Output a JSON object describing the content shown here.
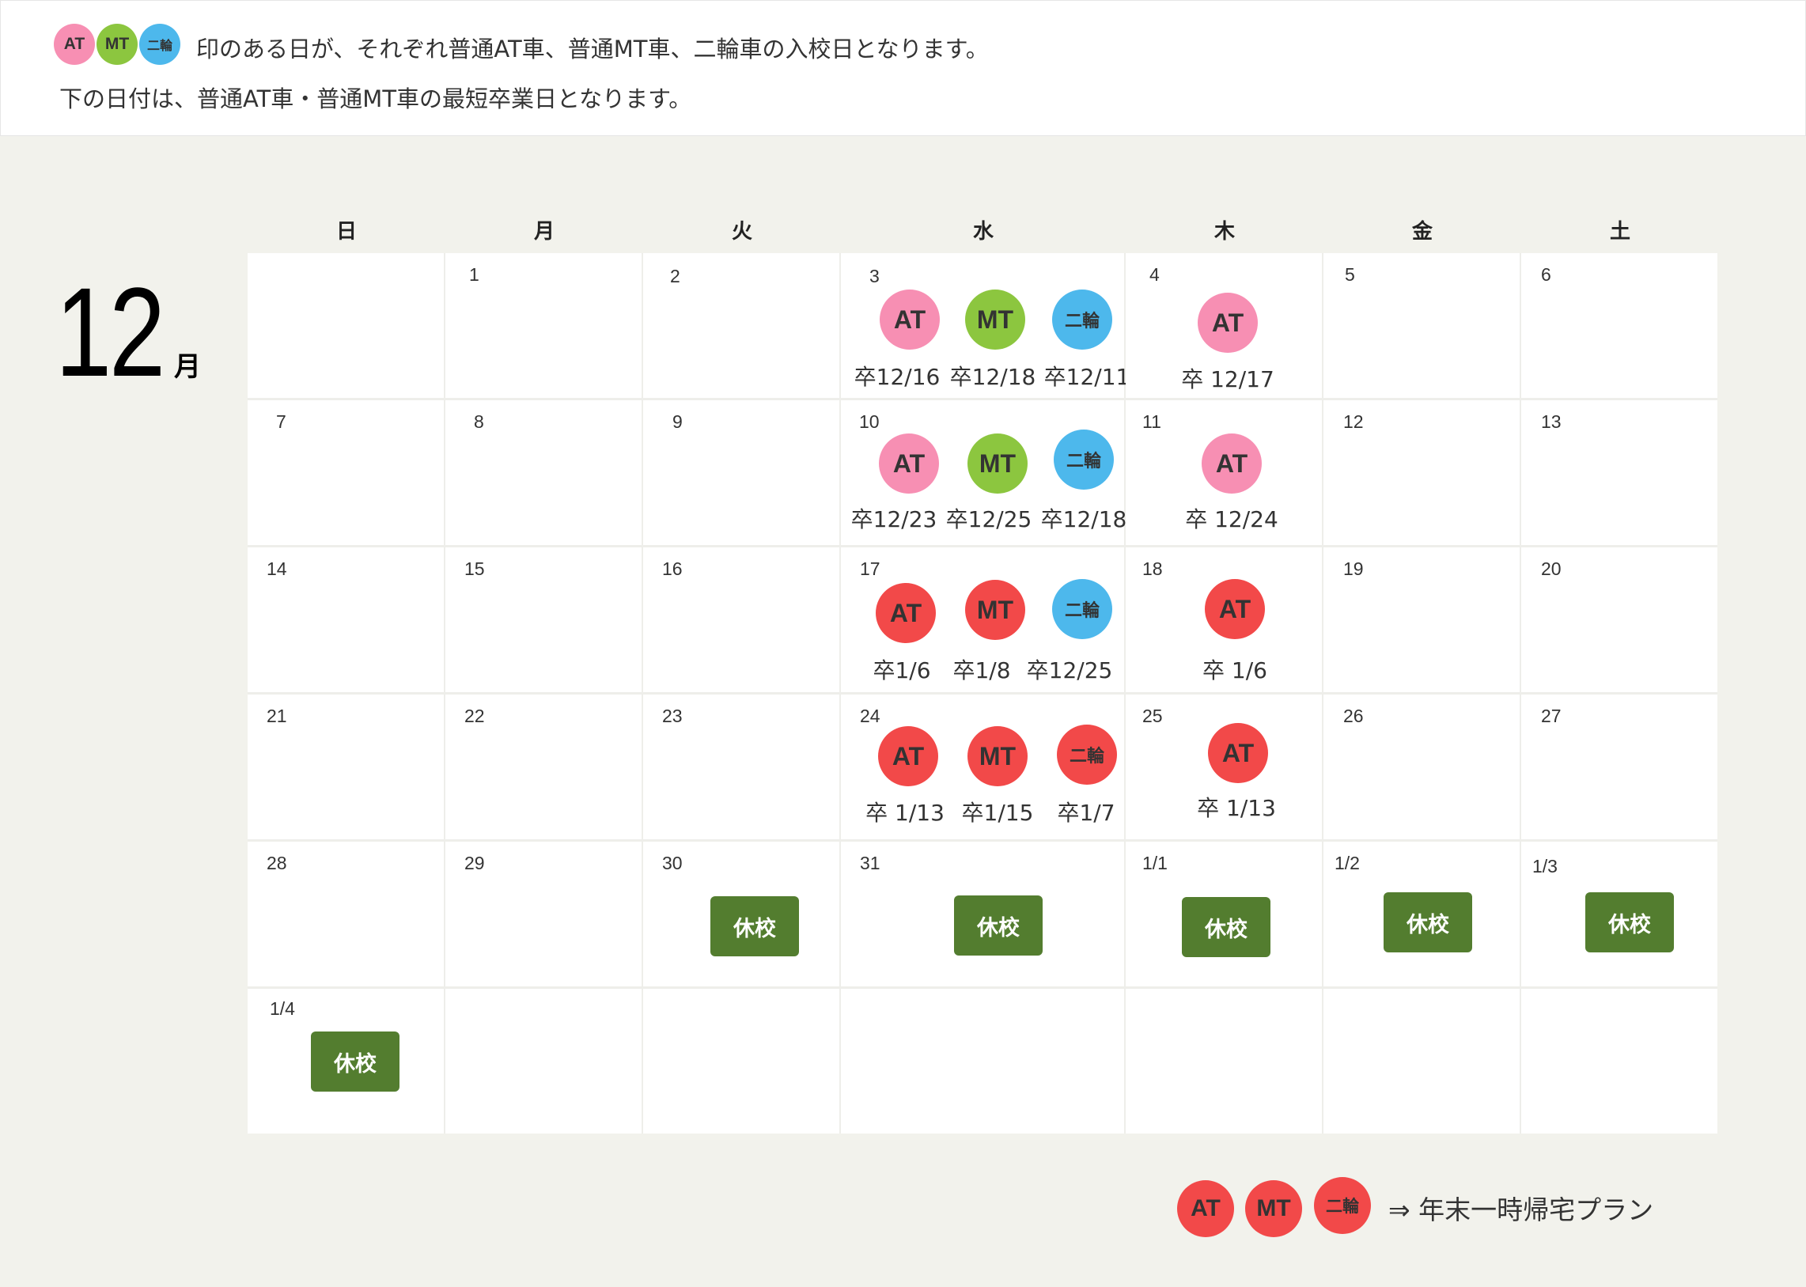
{
  "legend": {
    "at": "AT",
    "mt": "MT",
    "nirin": "二輪",
    "intro_line1": "印のある日が、それぞれ普通AT車、普通MT車、二輪車の入校日となります。",
    "intro_line2": "下の日付は、普通AT車・普通MT車の最短卒業日となります。"
  },
  "month": {
    "number": "12",
    "unit": "月"
  },
  "weekdays": [
    "日",
    "月",
    "火",
    "水",
    "木",
    "金",
    "土"
  ],
  "days": {
    "r0": [
      "",
      "1",
      "2",
      "3",
      "4",
      "5",
      "6"
    ],
    "r1": [
      "7",
      "8",
      "9",
      "10",
      "11",
      "12",
      "13"
    ],
    "r2": [
      "14",
      "15",
      "16",
      "17",
      "18",
      "19",
      "20"
    ],
    "r3": [
      "21",
      "22",
      "23",
      "24",
      "25",
      "26",
      "27"
    ],
    "r4": [
      "28",
      "29",
      "30",
      "31",
      "1/1",
      "1/2",
      "1/3"
    ],
    "r5": [
      "1/4"
    ]
  },
  "entries": {
    "d3": {
      "at": "AT",
      "mt": "MT",
      "nirin": "二輪",
      "at_grad": "卒12/16",
      "mt_grad": "卒12/18",
      "nirin_grad": "卒12/11"
    },
    "d4": {
      "at": "AT",
      "at_grad": "卒 12/17"
    },
    "d10": {
      "at": "AT",
      "mt": "MT",
      "nirin": "二輪",
      "at_grad": "卒12/23",
      "mt_grad": "卒12/25",
      "nirin_grad": "卒12/18"
    },
    "d11": {
      "at": "AT",
      "at_grad": "卒 12/24"
    },
    "d17": {
      "at": "AT",
      "mt": "MT",
      "nirin": "二輪",
      "at_grad": "卒1/6",
      "mt_grad": "卒1/8",
      "nirin_grad": "卒12/25"
    },
    "d18": {
      "at": "AT",
      "at_grad": "卒 1/6"
    },
    "d24": {
      "at": "AT",
      "mt": "MT",
      "nirin": "二輪",
      "at_grad": "卒 1/13",
      "mt_grad": "卒1/15",
      "nirin_grad": "卒1/7"
    },
    "d25": {
      "at": "AT",
      "at_grad": "卒 1/13"
    }
  },
  "holiday_label": "休校",
  "footer": {
    "at": "AT",
    "mt": "MT",
    "nirin": "二輪",
    "plan_text": "⇒ 年末一時帰宅プラン"
  },
  "colors": {
    "pink": "#f78fb3",
    "green": "#8cc63f",
    "blue": "#4db8ec",
    "red": "#f24949",
    "holiday_green": "#537d2f",
    "panel_bg": "#f2f2ec"
  }
}
